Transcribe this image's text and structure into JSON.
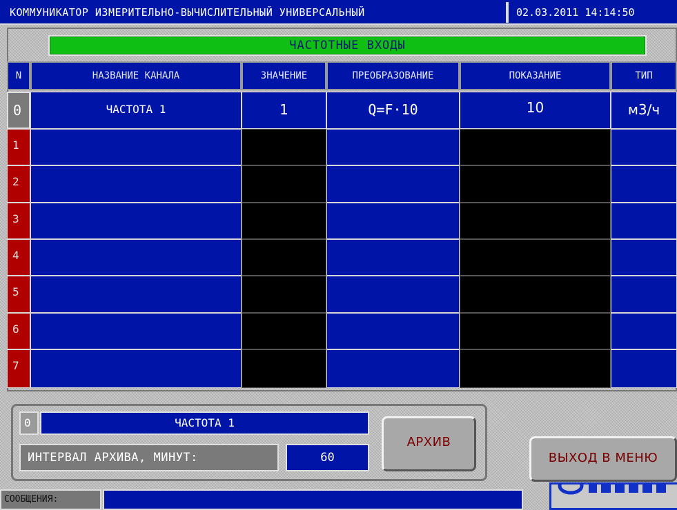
{
  "header": {
    "title": "КОММУНИКАТОР ИЗМЕРИТЕЛЬНО-ВЫЧИСЛИТЕЛЬНЫЙ УНИВЕРСАЛЬНЫЙ",
    "datetime": "02.03.2011 14:14:50"
  },
  "section_title": "ЧАСТОТНЫЕ ВХОДЫ",
  "table": {
    "columns": [
      "N",
      "НАЗВАНИЕ КАНАЛА",
      "ЗНАЧЕНИЕ",
      "ПРЕОБРАЗОВАНИЕ",
      "ПОКАЗАНИЕ",
      "ТИП"
    ],
    "rows": [
      {
        "n": "0",
        "name": "ЧАСТОТА 1",
        "value": "1",
        "transform": "Q=F·10",
        "reading": "10",
        "unit": "м3/ч"
      },
      {
        "n": "1",
        "name": "",
        "value": "",
        "transform": "",
        "reading": "",
        "unit": ""
      },
      {
        "n": "2",
        "name": "",
        "value": "",
        "transform": "",
        "reading": "",
        "unit": ""
      },
      {
        "n": "3",
        "name": "",
        "value": "",
        "transform": "",
        "reading": "",
        "unit": ""
      },
      {
        "n": "4",
        "name": "",
        "value": "",
        "transform": "",
        "reading": "",
        "unit": ""
      },
      {
        "n": "5",
        "name": "",
        "value": "",
        "transform": "",
        "reading": "",
        "unit": ""
      },
      {
        "n": "6",
        "name": "",
        "value": "",
        "transform": "",
        "reading": "",
        "unit": ""
      },
      {
        "n": "7",
        "name": "",
        "value": "",
        "transform": "",
        "reading": "",
        "unit": ""
      }
    ]
  },
  "selected": {
    "number": "0",
    "name": "ЧАСТОТА 1",
    "interval_label": "ИНТЕРВАЛ АРХИВА, МИНУТ:",
    "interval_value": "60"
  },
  "buttons": {
    "archive": "АРХИВ",
    "exit": "ВЫХОД В МЕНЮ"
  },
  "footer": {
    "messages_label": "СООБЩЕНИЯ:",
    "message": ""
  },
  "colors": {
    "panel_blue": "#0015a8",
    "header_green": "#0fbf14",
    "row_index_red": "#b00000",
    "button_text": "#7a0000"
  }
}
